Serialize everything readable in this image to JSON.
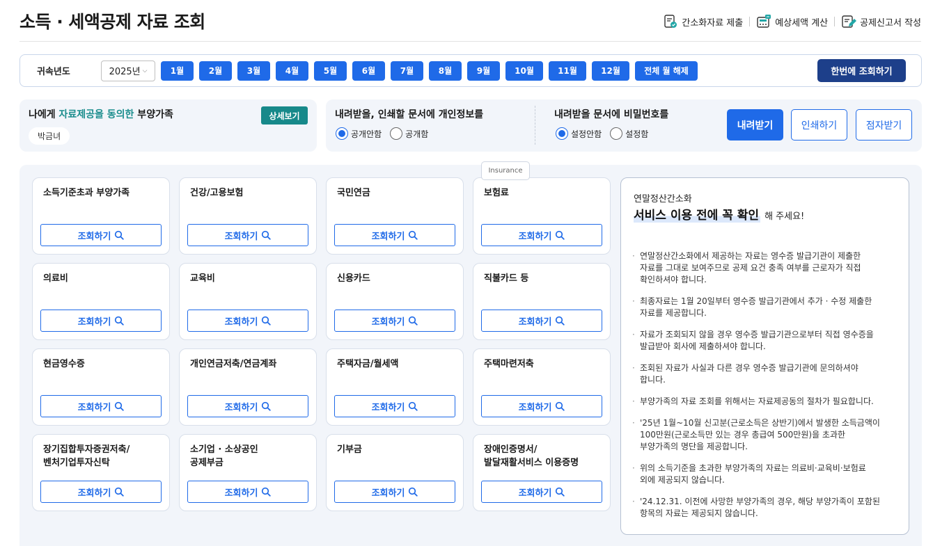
{
  "header": {
    "title": "소득 · 세액공제 자료 조회",
    "actions": [
      {
        "label": "간소화자료 제출",
        "icon": "document-check-icon"
      },
      {
        "label": "예상세액 계산",
        "icon": "calculator-icon"
      },
      {
        "label": "공제신고서 작성",
        "icon": "form-edit-icon"
      }
    ]
  },
  "year_bar": {
    "label": "귀속년도",
    "selected_year": "2025년",
    "months": [
      "1월",
      "2월",
      "3월",
      "4월",
      "5월",
      "6월",
      "7월",
      "8월",
      "9월",
      "10월",
      "11월",
      "12월"
    ],
    "clear_label": "전체 월 해제",
    "query_all_label": "한번에 조회하기"
  },
  "dependents": {
    "title_prefix": "나에게 ",
    "title_highlight": "자료제공을 동의한",
    "title_suffix": " 부양가족",
    "detail_label": "상세보기",
    "names": [
      "박금녀"
    ]
  },
  "options": {
    "privacy_title": "내려받을, 인쇄할 문서에 개인정보를",
    "privacy_options": [
      {
        "label": "공개안함",
        "selected": true
      },
      {
        "label": "공개함",
        "selected": false
      }
    ],
    "password_title": "내려받을 문서에 비밀번호를",
    "password_options": [
      {
        "label": "설정안함",
        "selected": true
      },
      {
        "label": "설정함",
        "selected": false
      }
    ],
    "download_label": "내려받기",
    "print_label": "인쇄하기",
    "braille_label": "점자받기"
  },
  "cards": [
    {
      "title": "소득기준초과 부양가족",
      "button": "조회하기"
    },
    {
      "title": "건강/고용보험",
      "button": "조회하기"
    },
    {
      "title": "국민연금",
      "button": "조회하기"
    },
    {
      "title": "보험료",
      "button": "조회하기"
    },
    {
      "title": "의료비",
      "button": "조회하기"
    },
    {
      "title": "교육비",
      "button": "조회하기"
    },
    {
      "title": "신용카드",
      "button": "조회하기"
    },
    {
      "title": "직불카드 등",
      "button": "조회하기"
    },
    {
      "title": "현금영수증",
      "button": "조회하기"
    },
    {
      "title": "개인연금저축/연금계좌",
      "button": "조회하기"
    },
    {
      "title": "주택자금/월세액",
      "button": "조회하기"
    },
    {
      "title": "주택마련저축",
      "button": "조회하기"
    },
    {
      "title": "장기집합투자증권저축/\n벤처기업투자신탁",
      "button": "조회하기"
    },
    {
      "title": "소기업 · 소상공인\n공제부금",
      "button": "조회하기"
    },
    {
      "title": "기부금",
      "button": "조회하기"
    },
    {
      "title": "장애인증명서/\n발달재활서비스 이용증명",
      "button": "조회하기"
    }
  ],
  "tooltip": "Insurance",
  "notice": {
    "subtitle": "연말정산간소화",
    "headline": "서비스 이용 전에 꼭 확인",
    "headline_suffix": "해 주세요!",
    "items": [
      "연말정산간소화에서 제공하는 자료는 영수증 발급기관이 제출한\n자료를 그대로 보여주므로 공제 요건 충족 여부를 근로자가 직접\n확인하셔야 합니다.",
      "최종자료는 1월 20일부터 영수증 발급기관에서 추가 · 수정 제출한\n자료를 제공합니다.",
      "자료가 조회되지 않을 경우 영수증 발급기관으로부터 직접 영수증을\n발급받아 회사에 제출하셔야 합니다.",
      "조회된 자료가 사실과 다른 경우 영수증 발급기관에 문의하셔야\n합니다.",
      "부양가족의 자료 조회를 위해서는 자료제공동의 절차가 필요합니다.",
      "'25년 1월~10월 신고분(근로소득은 상반기)에서 발생한 소득금액이\n100만원(근로소득만 있는 경우 총급여 500만원)을 초과한\n부양가족의 명단을 제공합니다.",
      "위의 소득기준을 초과한 부양가족의 자료는 의료비·교육비·보험료\n외에 제공되지 않습니다.",
      "'24.12.31. 이전에 사망한 부양가족의 경우, 해당 부양가족이 포함된\n항목의 자료는 제공되지 않습니다."
    ]
  },
  "colors": {
    "primary": "#1f6ae8",
    "navy": "#1d3f8a",
    "teal": "#17898a",
    "panel_bg": "#f2f5fa"
  }
}
